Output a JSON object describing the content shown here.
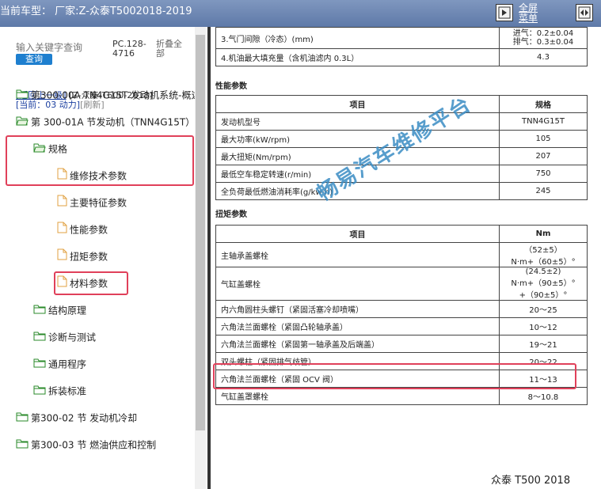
{
  "header": {
    "title": "当前车型： 厂家:Z-众泰T5002018-2019",
    "fullscreen_label": "全屏",
    "menu_label": "菜单"
  },
  "search": {
    "placeholder": "输入关键字查询",
    "button_label": "查询",
    "code": "PC.128-4716",
    "collapse_label": "折叠全部"
  },
  "nav": {
    "back_label": "[返回上一级]",
    "breadcrumb": "[Z-众泰-T500-2018]",
    "current_prefix": "[当前：",
    "current_value": "03 动力]",
    "refresh_label": "[刷新]"
  },
  "tree": [
    {
      "label": "第300-00A TN4G15T 发动机系统-概述",
      "type": "folder"
    },
    {
      "label": "第 300-01A 节发动机（TNN4G15T）",
      "type": "folder-open"
    },
    {
      "label": "规格",
      "type": "folder-open"
    },
    {
      "label": "维修技术参数",
      "type": "doc"
    },
    {
      "label": "主要特征参数",
      "type": "doc"
    },
    {
      "label": "性能参数",
      "type": "doc"
    },
    {
      "label": "扭矩参数",
      "type": "doc"
    },
    {
      "label": "材料参数",
      "type": "doc"
    },
    {
      "label": "结构原理",
      "type": "folder"
    },
    {
      "label": "诊断与测试",
      "type": "folder"
    },
    {
      "label": "通用程序",
      "type": "folder"
    },
    {
      "label": "拆装标准",
      "type": "folder"
    },
    {
      "label": "第300-02 节 发动机冷却",
      "type": "folder"
    },
    {
      "label": "第300-03 节 燃油供应和控制",
      "type": "folder"
    }
  ],
  "doc": {
    "top_rows": [
      {
        "item": "3.气门间隙（冷态）(mm)",
        "value_line1": "进气：0.2±0.04",
        "value_line2": "排气：0.3±0.04"
      },
      {
        "item": "4.机油最大填充量（含机油滤内 0.3L）",
        "value": "4.3"
      }
    ],
    "performance_title": "性能参数",
    "performance_headers": [
      "项目",
      "规格"
    ],
    "performance_rows": [
      [
        "发动机型号",
        "TNN4G15T"
      ],
      [
        "最大功率(kW/rpm)",
        "105"
      ],
      [
        "最大扭矩(Nm/rpm)",
        "207"
      ],
      [
        "最低空车稳定转速(r/min)",
        "750"
      ],
      [
        "全负荷最低燃油消耗率(g/kw·h)",
        "245"
      ]
    ],
    "torque_title": "扭矩参数",
    "torque_headers": [
      "项目",
      "Nm"
    ],
    "torque_rows": [
      [
        "主轴承盖螺栓",
        "（52±5）N·m+（60±5）°"
      ],
      [
        "气缸盖螺栓",
        "(24.5±2) N·m+（90±5）°+（90±5）°"
      ],
      [
        "内六角圆柱头螺钉（紧固活塞冷却喷嘴）",
        "20～25"
      ],
      [
        "六角法兰面螺栓（紧固凸轮轴承盖）",
        "10～12"
      ],
      [
        "六角法兰面螺栓（紧固第一轴承盖及后端盖）",
        "19～21"
      ],
      [
        "双头螺柱（紧固排气歧管）",
        "20～22"
      ],
      [
        "六角法兰面螺栓（紧固 OCV 阀）",
        "11～13"
      ],
      [
        "气缸盖罩螺栓",
        "8～10.8"
      ]
    ],
    "watermark": "畅易汽车维修平台",
    "footer": "众泰 T500 2018"
  }
}
